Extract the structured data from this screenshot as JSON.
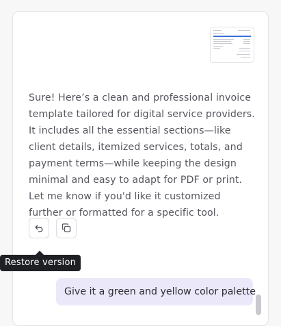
{
  "assistant_message": {
    "text": "Sure! Here’s a clean and professional invoice template tailored for digital service providers. It includes all the essential sections—like client details, itemized services, totals, and payment terms—while keeping the design minimal and easy to adapt for PDF or print. Let me know if you'd like it customized further or formatted for a specific tool."
  },
  "actions": {
    "restore_icon": "undo-arrow-icon",
    "copy_icon": "copy-icon",
    "tooltip": "Restore version"
  },
  "user_message": {
    "text": "Give it a green and yellow color palette"
  },
  "colors": {
    "user_bubble": "#ebe8f9",
    "tooltip_bg": "#1f2024",
    "thumbnail_accent": "#3b6fd8"
  }
}
